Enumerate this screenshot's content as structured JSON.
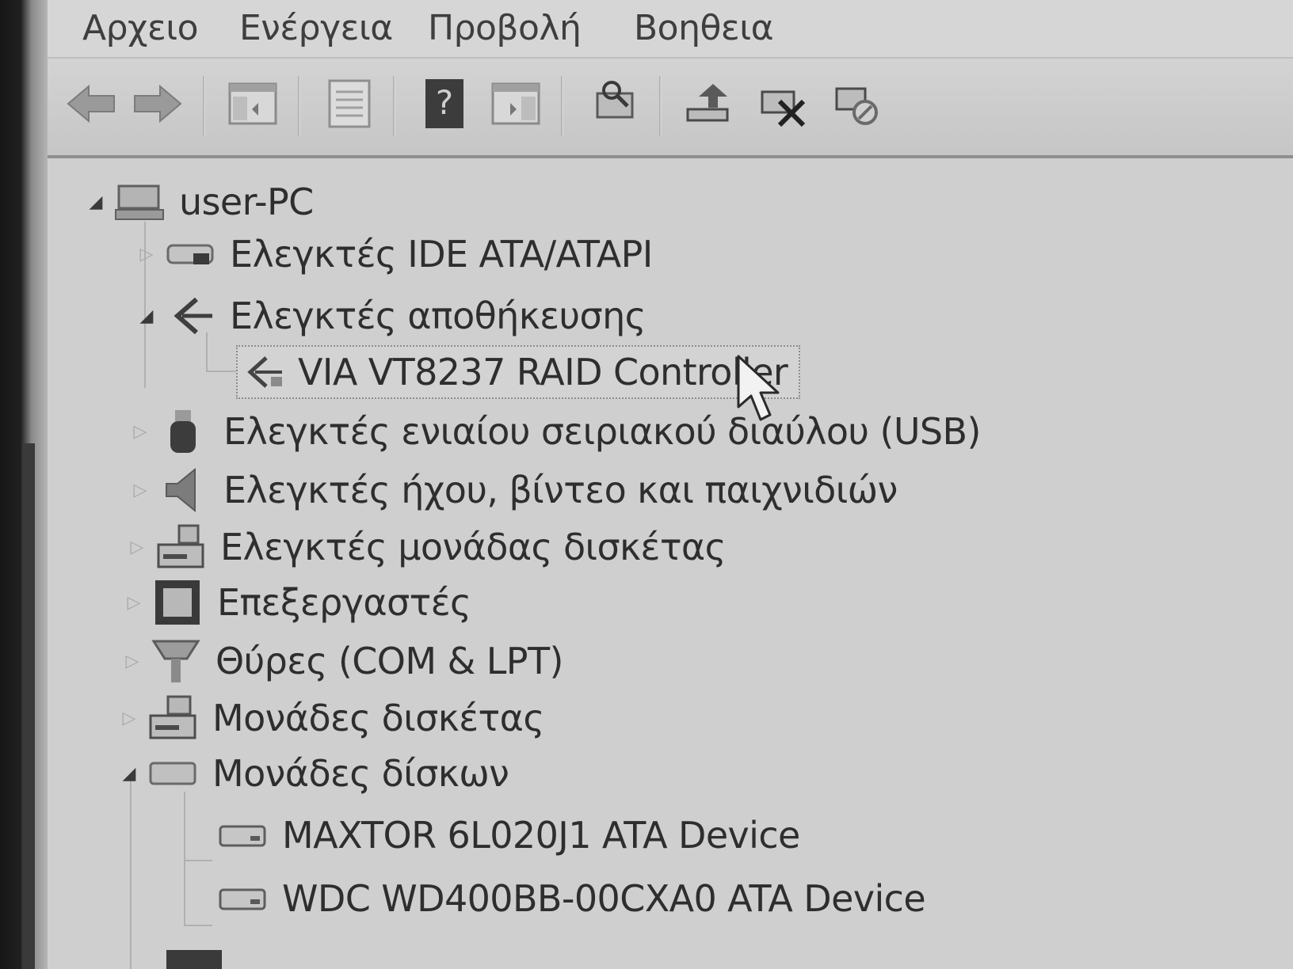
{
  "menu": {
    "items": [
      {
        "label": "Αρχειο"
      },
      {
        "label": "Ενέργεια"
      },
      {
        "label": "Προβολή"
      },
      {
        "label": "Βοηθεια"
      }
    ]
  },
  "toolbar": {
    "buttons": [
      {
        "icon": "back-arrow-icon"
      },
      {
        "icon": "forward-arrow-icon"
      },
      {
        "icon": "show-hide-console-tree-icon"
      },
      {
        "icon": "properties-icon"
      },
      {
        "icon": "help-icon"
      },
      {
        "icon": "action-pane-icon"
      },
      {
        "icon": "scan-hardware-changes-icon"
      },
      {
        "icon": "update-driver-icon"
      },
      {
        "icon": "uninstall-device-icon"
      },
      {
        "icon": "disable-device-icon"
      }
    ]
  },
  "tree": {
    "root": {
      "label": "user-PC",
      "expanded": true
    },
    "nodes": [
      {
        "label": "Ελεγκτές IDE ATA/ATAPI",
        "expanded": false,
        "icon": "ide-controller-icon"
      },
      {
        "label": "Ελεγκτές αποθήκευσης",
        "expanded": true,
        "icon": "storage-controller-icon"
      },
      {
        "label": "VIA VT8237 RAID Controller",
        "icon": "raid-controller-icon",
        "selected": true
      },
      {
        "label": "Ελεγκτές ενιαίου σειριακού διαύλου (USB)",
        "expanded": false,
        "icon": "usb-icon"
      },
      {
        "label": "Ελεγκτές ήχου, βίντεο και παιχνιδιών",
        "expanded": false,
        "icon": "speaker-icon"
      },
      {
        "label": "Ελεγκτές μονάδας δισκέτας",
        "expanded": false,
        "icon": "floppy-controller-icon"
      },
      {
        "label": "Επεξεργαστές",
        "expanded": false,
        "icon": "processor-icon"
      },
      {
        "label": "Θύρες (COM & LPT)",
        "expanded": false,
        "icon": "port-icon"
      },
      {
        "label": "Μονάδες δισκέτας",
        "expanded": false,
        "icon": "floppy-drive-icon"
      },
      {
        "label": "Μονάδες δίσκων",
        "expanded": true,
        "icon": "disk-drive-icon"
      },
      {
        "label": "MAXTOR 6L020J1 ATA Device",
        "icon": "hard-disk-icon"
      },
      {
        "label": "WDC WD400BB-00CXA0 ATA Device",
        "icon": "hard-disk-icon"
      }
    ]
  }
}
